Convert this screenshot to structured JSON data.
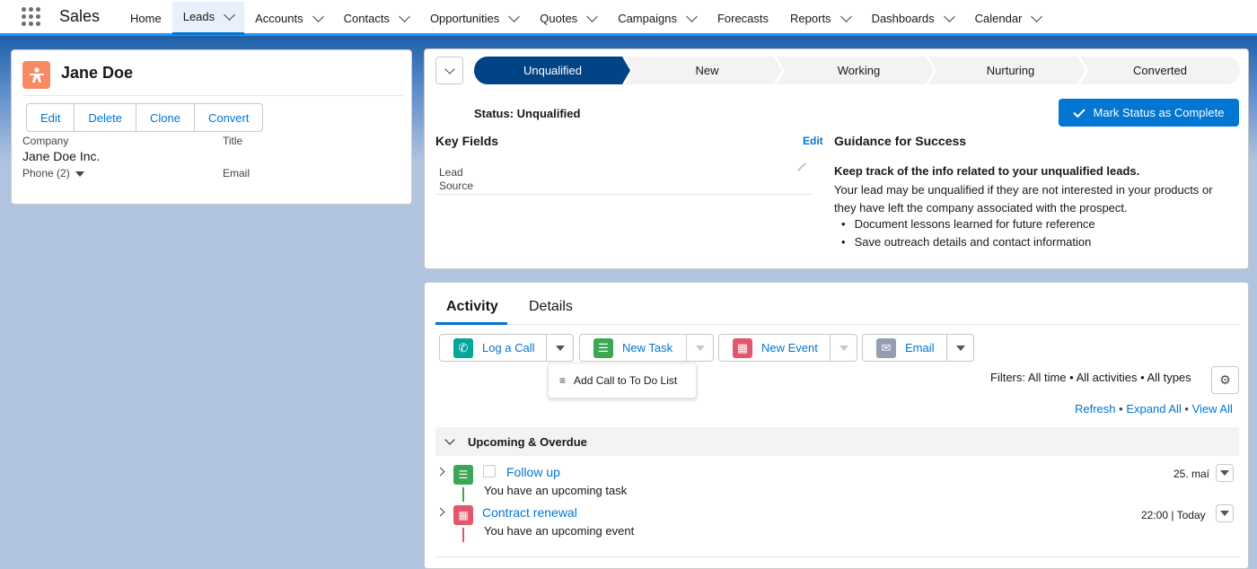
{
  "app": {
    "name": "Sales"
  },
  "nav": [
    {
      "label": "Home",
      "chevron": false,
      "active": false
    },
    {
      "label": "Leads",
      "chevron": true,
      "active": true
    },
    {
      "label": "Accounts",
      "chevron": true,
      "active": false
    },
    {
      "label": "Contacts",
      "chevron": true,
      "active": false
    },
    {
      "label": "Opportunities",
      "chevron": true,
      "active": false
    },
    {
      "label": "Quotes",
      "chevron": true,
      "active": false
    },
    {
      "label": "Campaigns",
      "chevron": true,
      "active": false
    },
    {
      "label": "Forecasts",
      "chevron": false,
      "active": false
    },
    {
      "label": "Reports",
      "chevron": true,
      "active": false
    },
    {
      "label": "Dashboards",
      "chevron": true,
      "active": false
    },
    {
      "label": "Calendar",
      "chevron": true,
      "active": false
    }
  ],
  "lead": {
    "name": "Jane Doe",
    "icon": "lead-person-icon",
    "actions": [
      "Edit",
      "Delete",
      "Clone",
      "Convert"
    ],
    "company_label": "Company",
    "company_value": "Jane Doe Inc.",
    "title_label": "Title",
    "phone_label": "Phone (2)",
    "email_label": "Email"
  },
  "path": {
    "steps": [
      {
        "label": "Unqualified",
        "current": true
      },
      {
        "label": "New",
        "current": false
      },
      {
        "label": "Working",
        "current": false
      },
      {
        "label": "Nurturing",
        "current": false
      },
      {
        "label": "Converted",
        "current": false
      }
    ],
    "status_text": "Status: Unqualified",
    "mark_button": "Mark Status as Complete",
    "key_fields_title": "Key Fields",
    "edit_label": "Edit",
    "lead_source_line1": "Lead",
    "lead_source_line2": "Source",
    "guidance_title": "Guidance for Success",
    "guidance_heading": "Keep track of the info related to your unqualified leads.",
    "guidance_body": "Your lead may be unqualified if they are not interested in your products or they have left the company associated with the prospect.",
    "guidance_bullets": [
      "Document lessons learned for future reference",
      "Save outreach details and contact information"
    ]
  },
  "activity": {
    "tabs": [
      "Activity",
      "Details"
    ],
    "buttons": [
      {
        "label": "Log a Call",
        "icon": "phone-icon",
        "color": "#06a59a"
      },
      {
        "label": "New Task",
        "icon": "task-icon",
        "color": "#3ba755"
      },
      {
        "label": "New Event",
        "icon": "calendar-icon",
        "color": "#e3566b"
      },
      {
        "label": "Email",
        "icon": "email-icon",
        "color": "#939fb1"
      }
    ],
    "menu_item": "Add Call to To Do List",
    "filters": "Filters: All time • All activities • All types",
    "links": [
      "Refresh",
      "Expand All",
      "View All"
    ],
    "section_title": "Upcoming & Overdue",
    "items": [
      {
        "title": "Follow up",
        "subtitle": "You have an upcoming task",
        "date": "25. maí",
        "icon": "task-icon"
      },
      {
        "title": "Contract renewal",
        "subtitle": "You have an upcoming event",
        "date": "22:00 | Today",
        "icon": "calendar-icon"
      }
    ]
  },
  "colors": {
    "brand": "#0176d3",
    "path_current": "#014486",
    "path_pending": "#f3f3f3",
    "lead_icon": "#f88962"
  }
}
